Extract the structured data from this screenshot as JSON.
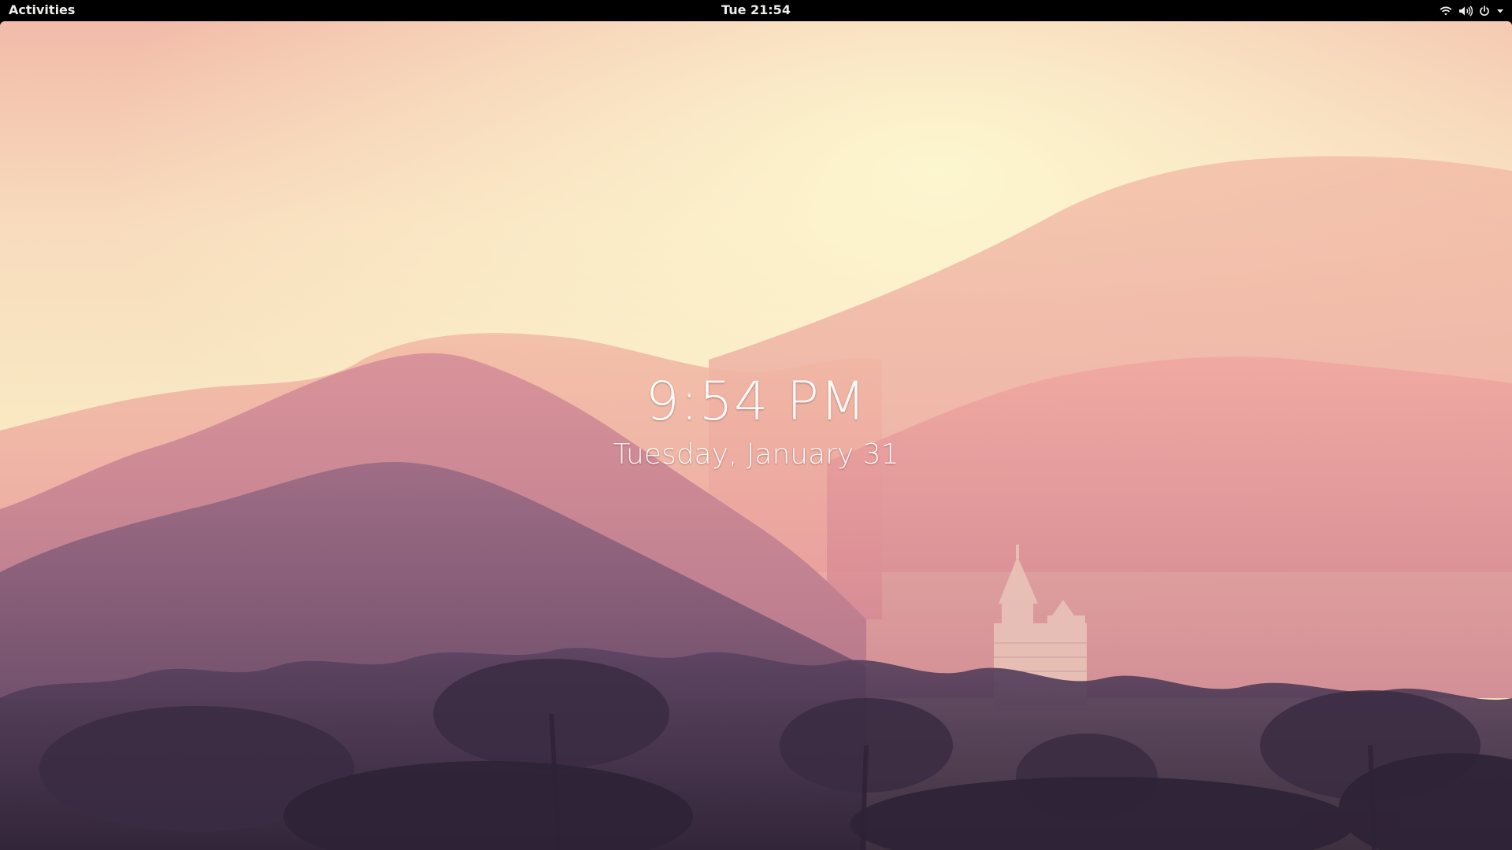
{
  "top_bar": {
    "activities_label": "Activities",
    "clock_label": "Tue 21:54",
    "status_icons": [
      "wifi-icon",
      "volume-icon",
      "power-icon",
      "chevron-down-icon"
    ]
  },
  "lock_screen": {
    "time": "9:54 PM",
    "date": "Tuesday, January 31"
  },
  "colors": {
    "bar_background": "#000000",
    "bar_text": "#eeeeec",
    "sky_top": "#f3b9a8",
    "sky_glow": "#fbf3c6",
    "hills_far": "#e79ea0",
    "hills_near": "#5e4564",
    "foreground": "#3a2a40"
  }
}
